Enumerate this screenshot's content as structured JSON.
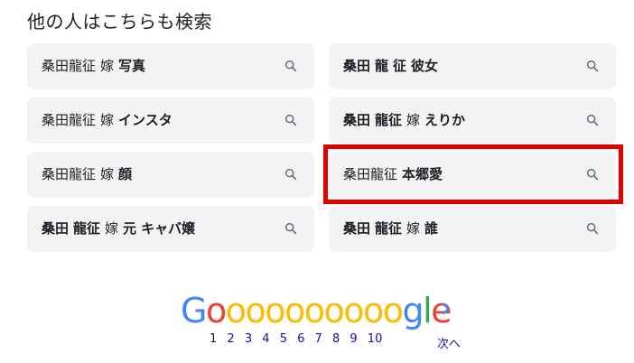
{
  "heading": "他の人はこちらも検索",
  "chips": [
    {
      "parts": [
        {
          "t": "桑田龍征"
        },
        {
          "sp": true
        },
        {
          "t": "嫁"
        },
        {
          "sp": true
        },
        {
          "t": "写真",
          "b": true
        }
      ]
    },
    {
      "parts": [
        {
          "t": "桑田",
          "b": true
        },
        {
          "sp": true
        },
        {
          "t": "龍",
          "b": true
        },
        {
          "sp": true
        },
        {
          "t": "征",
          "b": true
        },
        {
          "sp": true
        },
        {
          "t": "彼女",
          "b": true
        }
      ]
    },
    {
      "parts": [
        {
          "t": "桑田龍征"
        },
        {
          "sp": true
        },
        {
          "t": "嫁"
        },
        {
          "sp": true
        },
        {
          "t": "インスタ",
          "b": true
        }
      ]
    },
    {
      "parts": [
        {
          "t": "桑田",
          "b": true
        },
        {
          "sp": true
        },
        {
          "t": "龍征",
          "b": true
        },
        {
          "sp": true
        },
        {
          "t": "嫁"
        },
        {
          "sp": true
        },
        {
          "t": "えりか",
          "b": true
        }
      ]
    },
    {
      "parts": [
        {
          "t": "桑田龍征"
        },
        {
          "sp": true
        },
        {
          "t": "嫁"
        },
        {
          "sp": true
        },
        {
          "t": "顔",
          "b": true
        }
      ]
    },
    {
      "parts": [
        {
          "t": "桑田龍征"
        },
        {
          "sp": true
        },
        {
          "t": "本郷愛",
          "b": true
        }
      ]
    },
    {
      "parts": [
        {
          "t": "桑田",
          "b": true
        },
        {
          "sp": true
        },
        {
          "t": "龍征",
          "b": true
        },
        {
          "sp": true
        },
        {
          "t": "嫁"
        },
        {
          "sp": true
        },
        {
          "t": "元",
          "b": true
        },
        {
          "sp": true
        },
        {
          "t": "キャバ嬢",
          "b": true
        }
      ]
    },
    {
      "parts": [
        {
          "t": "桑田",
          "b": true
        },
        {
          "sp": true
        },
        {
          "t": "龍征",
          "b": true
        },
        {
          "sp": true
        },
        {
          "t": "嫁"
        },
        {
          "sp": true
        },
        {
          "t": "誰",
          "b": true
        }
      ]
    }
  ],
  "logo": {
    "letters": [
      {
        "ch": "G",
        "color": "#4285f4"
      },
      {
        "ch": "o",
        "color": "#ea4335"
      },
      {
        "ch": "o",
        "color": "#fbbc05"
      },
      {
        "ch": "o",
        "color": "#fbbc05"
      },
      {
        "ch": "o",
        "color": "#fbbc05"
      },
      {
        "ch": "o",
        "color": "#fbbc05"
      },
      {
        "ch": "o",
        "color": "#fbbc05"
      },
      {
        "ch": "o",
        "color": "#fbbc05"
      },
      {
        "ch": "o",
        "color": "#fbbc05"
      },
      {
        "ch": "o",
        "color": "#fbbc05"
      },
      {
        "ch": "o",
        "color": "#fbbc05"
      },
      {
        "ch": "g",
        "color": "#4285f4"
      },
      {
        "ch": "l",
        "color": "#34a853"
      },
      {
        "ch": "e",
        "color": "#ea4335"
      }
    ]
  },
  "pagination": {
    "current": "1",
    "pages": [
      "2",
      "3",
      "4",
      "5",
      "6",
      "7",
      "8",
      "9",
      "10"
    ],
    "next_label": "次へ",
    "next_icon": "chevron-right-icon"
  },
  "search_icon": "search-icon",
  "colors": {
    "chip_bg": "#f1f3f4",
    "highlight": "#e00000",
    "link": "#1a0dab"
  }
}
